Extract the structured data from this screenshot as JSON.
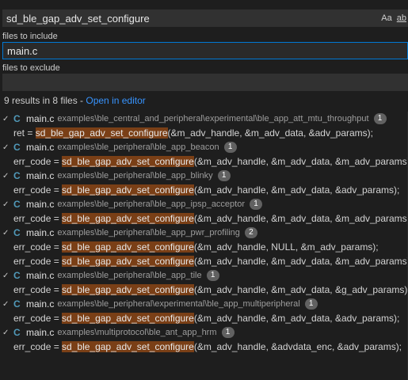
{
  "search": {
    "query": "sd_ble_gap_adv_set_configure",
    "match_case": "Aa",
    "whole_word": "ab"
  },
  "include": {
    "label": "files to include",
    "value": "main.c"
  },
  "exclude": {
    "label": "files to exclude",
    "value": ""
  },
  "summary": {
    "text": "9 results in 8 files - ",
    "open_in_editor": "Open in editor"
  },
  "results": [
    {
      "file": "main.c",
      "path": "examples\\ble_central_and_peripheral\\experimental\\ble_app_att_mtu_throughput",
      "count": "1",
      "matches": [
        {
          "pre": "ret = ",
          "hit": "sd_ble_gap_adv_set_configure",
          "post": "(&m_adv_handle, &m_adv_data, &adv_params);"
        }
      ]
    },
    {
      "file": "main.c",
      "path": "examples\\ble_peripheral\\ble_app_beacon",
      "count": "1",
      "matches": [
        {
          "pre": "err_code = ",
          "hit": "sd_ble_gap_adv_set_configure",
          "post": "(&m_adv_handle, &m_adv_data, &m_adv_params);"
        }
      ]
    },
    {
      "file": "main.c",
      "path": "examples\\ble_peripheral\\ble_app_blinky",
      "count": "1",
      "matches": [
        {
          "pre": "err_code = ",
          "hit": "sd_ble_gap_adv_set_configure",
          "post": "(&m_adv_handle, &m_adv_data, &adv_params);"
        }
      ]
    },
    {
      "file": "main.c",
      "path": "examples\\ble_peripheral\\ble_app_ipsp_acceptor",
      "count": "1",
      "matches": [
        {
          "pre": "err_code = ",
          "hit": "sd_ble_gap_adv_set_configure",
          "post": "(&m_adv_handle, &m_adv_data, &m_adv_params);"
        }
      ]
    },
    {
      "file": "main.c",
      "path": "examples\\ble_peripheral\\ble_app_pwr_profiling",
      "count": "2",
      "matches": [
        {
          "pre": "err_code = ",
          "hit": "sd_ble_gap_adv_set_configure",
          "post": "(&m_adv_handle, NULL, &m_adv_params);"
        },
        {
          "pre": "err_code = ",
          "hit": "sd_ble_gap_adv_set_configure",
          "post": "(&m_adv_handle, &m_adv_data, &m_adv_params);"
        }
      ]
    },
    {
      "file": "main.c",
      "path": "examples\\ble_peripheral\\ble_app_tile",
      "count": "1",
      "matches": [
        {
          "pre": "err_code = ",
          "hit": "sd_ble_gap_adv_set_configure",
          "post": "(&m_adv_handle, &m_adv_data, &g_adv_params);"
        }
      ]
    },
    {
      "file": "main.c",
      "path": "examples\\ble_peripheral\\experimental\\ble_app_multiperipheral",
      "count": "1",
      "matches": [
        {
          "pre": "err_code = ",
          "hit": "sd_ble_gap_adv_set_configure",
          "post": "(&m_adv_handle, &m_adv_data, &adv_params);"
        }
      ]
    },
    {
      "file": "main.c",
      "path": "examples\\multiprotocol\\ble_ant_app_hrm",
      "count": "1",
      "matches": [
        {
          "pre": "err_code = ",
          "hit": "sd_ble_gap_adv_set_configure",
          "post": "(&m_adv_handle, &advdata_enc, &adv_params);"
        }
      ]
    }
  ],
  "icons": {
    "chevron": "chevron-down-icon",
    "file_type": "c-file-icon",
    "file_icon_glyph": "C",
    "chevron_glyph": "✓"
  },
  "colors": {
    "highlight": "#7a3f16",
    "link": "#3794ff",
    "focus_border": "#0078d4",
    "c_icon": "#519aba"
  }
}
